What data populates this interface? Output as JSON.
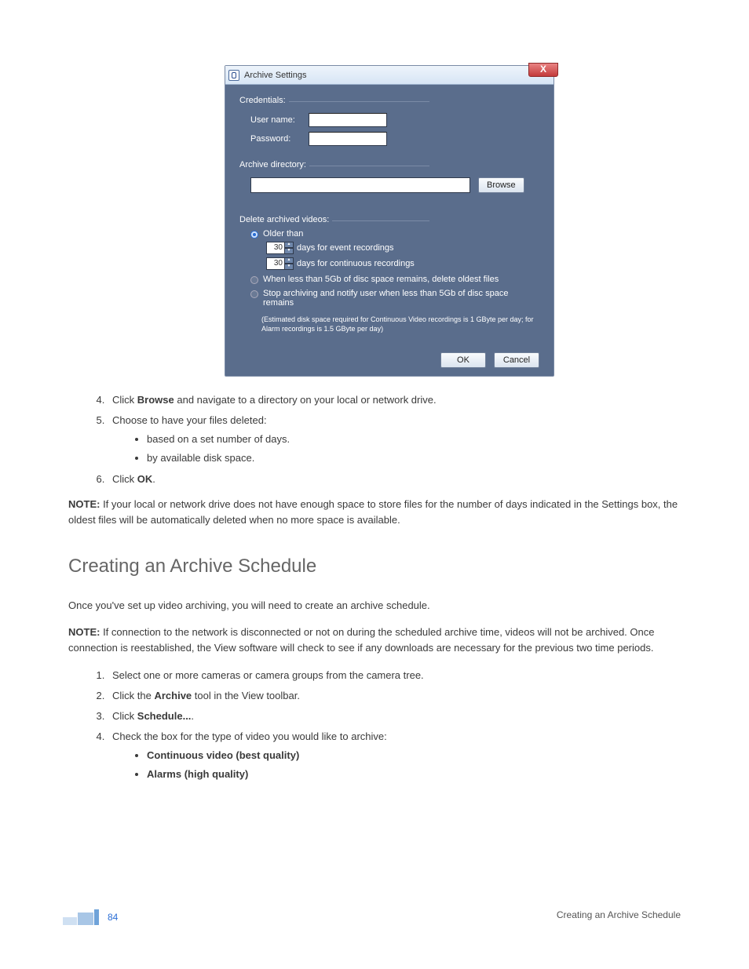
{
  "dialog": {
    "title": "Archive Settings",
    "close_label": "X",
    "credentials": {
      "legend": "Credentials:",
      "username_label": "User name:",
      "password_label": "Password:",
      "username_value": "",
      "password_value": ""
    },
    "archive_dir": {
      "legend": "Archive directory:",
      "value": "",
      "browse_label": "Browse"
    },
    "delete": {
      "legend": "Delete archived videos:",
      "older_than_label": "Older than",
      "event_days": "30",
      "event_suffix": "days for event recordings",
      "cont_days": "30",
      "cont_suffix": "days for continuous recordings",
      "opt2": "When less than 5Gb of disc space remains, delete oldest files",
      "opt3": "Stop archiving and notify user when less than 5Gb of disc space remains",
      "estimate": "(Estimated disk space required for Continuous Video recordings is 1 GByte per day; for Alarm recordings is 1.5 GByte per day)"
    },
    "ok_label": "OK",
    "cancel_label": "Cancel"
  },
  "doc": {
    "step4_a": "Click ",
    "step4_b": "Browse",
    "step4_c": " and navigate to a directory on your local or network drive.",
    "step5": "Choose to have your files deleted:",
    "step5_sub1": "based on a set number of days.",
    "step5_sub2": "by available disk space.",
    "step6_a": "Click ",
    "step6_b": "OK",
    "step6_c": ".",
    "note1_prefix": "NOTE:",
    "note1_body": " If your local or network drive does not have enough space to store files for the number of days indicated in the Settings box, the oldest files will be automatically deleted when no more space is available.",
    "h2": "Creating an Archive Schedule",
    "p2": "Once you've set up video archiving, you will need to create an archive schedule.",
    "note2_prefix": "NOTE:",
    "note2_body": " If connection to the network is disconnected or not on during the scheduled archive time, videos will not be archived. Once connection is reestablished, the View software will check to see if any downloads are necessary for the previous two time periods.",
    "s1": "Select one or more cameras or camera groups from the camera tree.",
    "s2_a": "Click the ",
    "s2_b": "Archive",
    "s2_c": " tool in the View toolbar.",
    "s3_a": "Click ",
    "s3_b": "Schedule...",
    "s3_c": ".",
    "s4": "Check the box for the type of video you would like to archive:",
    "s4_sub1": "Continuous video (best quality)",
    "s4_sub2": "Alarms (high quality)"
  },
  "footer": {
    "page": "84",
    "right": "Creating an Archive Schedule"
  }
}
